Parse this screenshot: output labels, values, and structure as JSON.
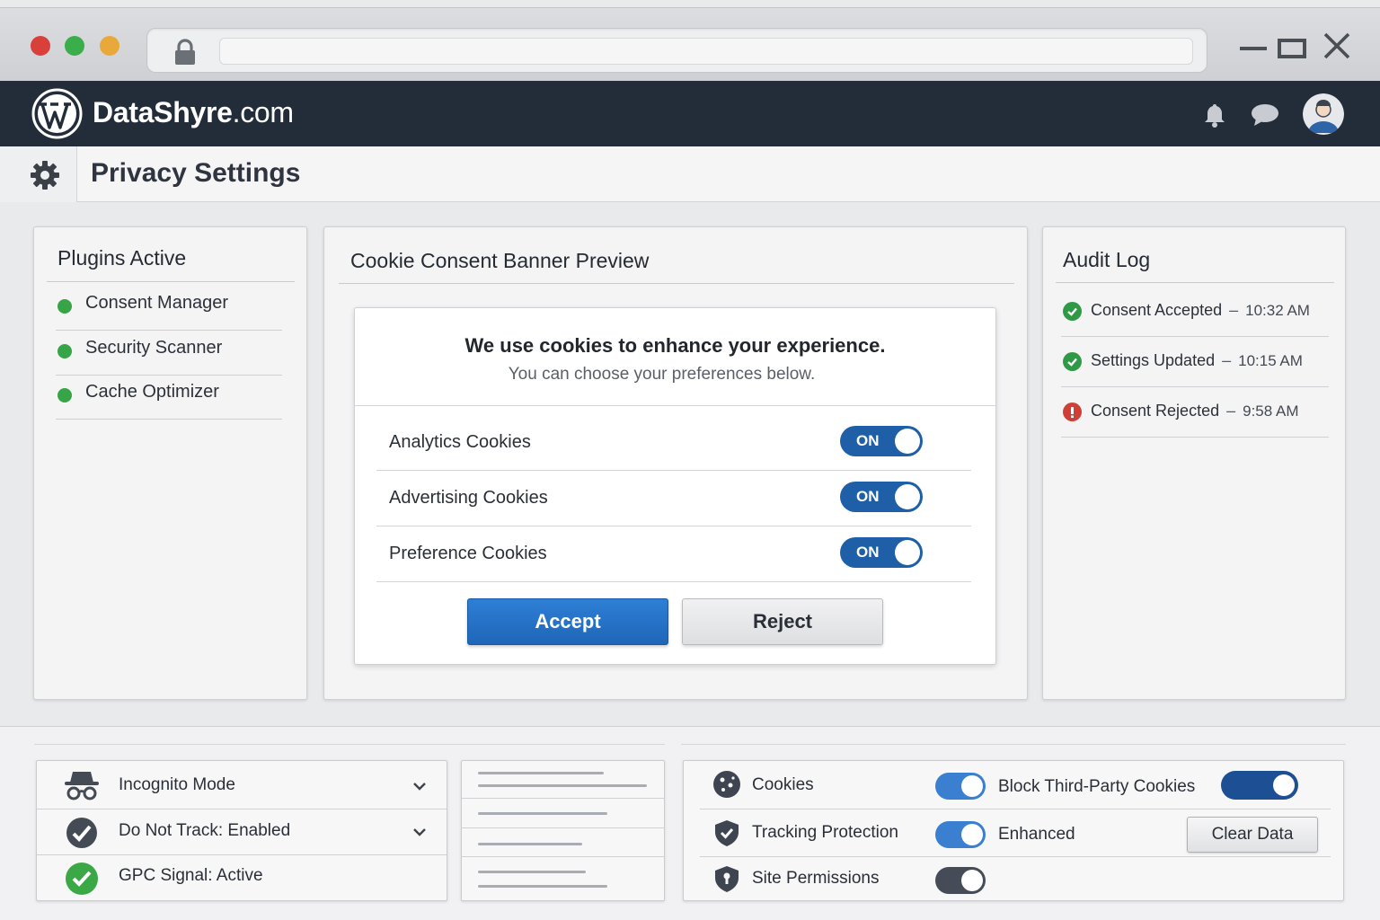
{
  "browser": {
    "window_controls": [
      "minimize-icon",
      "maximize-icon",
      "close-icon"
    ],
    "traffic_lights": [
      "#d9403a",
      "#3aae4a",
      "#e9a93a"
    ],
    "address_icon": "lock-icon",
    "address_value": ""
  },
  "header": {
    "site_name_bold": "DataShyre",
    "site_name_suffix": ".com",
    "logo_icon": "wordpress-logo",
    "icons": [
      "bell-icon",
      "chat-icon",
      "user-avatar"
    ],
    "background": "#232d3a"
  },
  "page": {
    "title": "Privacy Settings",
    "icon": "gear-icon"
  },
  "plugins": {
    "title": "Plugins Active",
    "items": [
      {
        "label": "Consent Manager",
        "status_color": "#37a447"
      },
      {
        "label": "Security Scanner",
        "status_color": "#37a447"
      },
      {
        "label": "Cache Optimizer",
        "status_color": "#37a447"
      }
    ]
  },
  "preview": {
    "title": "Cookie Consent Banner Preview",
    "banner": {
      "headline": "We use cookies to enhance your experience.",
      "subtext": "You can choose your preferences below.",
      "toggles": [
        {
          "label": "Analytics Cookies",
          "state": "ON"
        },
        {
          "label": "Advertising Cookies",
          "state": "ON"
        },
        {
          "label": "Preference Cookies",
          "state": "ON"
        }
      ],
      "accept_label": "Accept",
      "reject_label": "Reject",
      "accent": "#1e5fa8"
    }
  },
  "audit": {
    "title": "Audit Log",
    "entries": [
      {
        "event": "Consent Accepted",
        "sep": "–",
        "time": "10:32 AM",
        "status": "success"
      },
      {
        "event": "Settings Updated",
        "sep": "–",
        "time": "10:15 AM",
        "status": "success"
      },
      {
        "event": "Consent Rejected",
        "sep": "–",
        "time": "9:58 AM",
        "status": "error"
      }
    ]
  },
  "browser_privacy": {
    "items": [
      {
        "label": "Incognito Mode",
        "icon": "incognito-icon",
        "expandable": true
      },
      {
        "label": "Do Not Track: Enabled",
        "icon": "shield-check-icon",
        "expandable": true
      },
      {
        "label": "GPC Signal: Active",
        "icon": "check-circle-icon",
        "expandable": false
      }
    ]
  },
  "site_settings": {
    "rows": [
      {
        "label": "Cookies",
        "icon": "cookie-icon",
        "toggle": true,
        "option": "Block Third-Party Cookies",
        "option_toggle": true
      },
      {
        "label": "Tracking Protection",
        "icon": "shield-icon",
        "toggle": true,
        "option": "Enhanced",
        "action": "Clear Data"
      },
      {
        "label": "Site Permissions",
        "icon": "lock-shield-icon",
        "toggle": true
      }
    ]
  }
}
